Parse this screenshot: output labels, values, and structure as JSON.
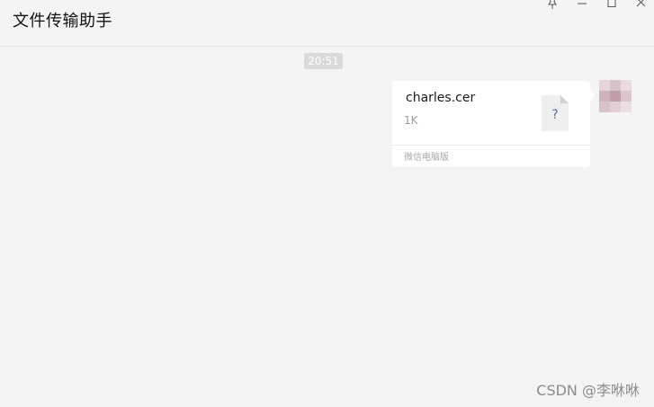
{
  "window": {
    "title": "文件传输助手",
    "controls": {
      "pin": "pin-icon",
      "minimize": "minimize-icon",
      "maximize": "maximize-icon",
      "close": "close-icon"
    }
  },
  "chat": {
    "timestamp": "20:51",
    "messages": [
      {
        "type": "file",
        "file_name": "charles.cer",
        "file_size": "1K",
        "file_icon_glyph": "?",
        "source": "微信电脑版"
      }
    ]
  },
  "watermark": "CSDN @李咻咻",
  "colors": {
    "background": "#f4f4f4",
    "bubble": "#ffffff",
    "timestamp_badge": "#dadada",
    "file_icon_glyph": "#5f6fa6"
  }
}
